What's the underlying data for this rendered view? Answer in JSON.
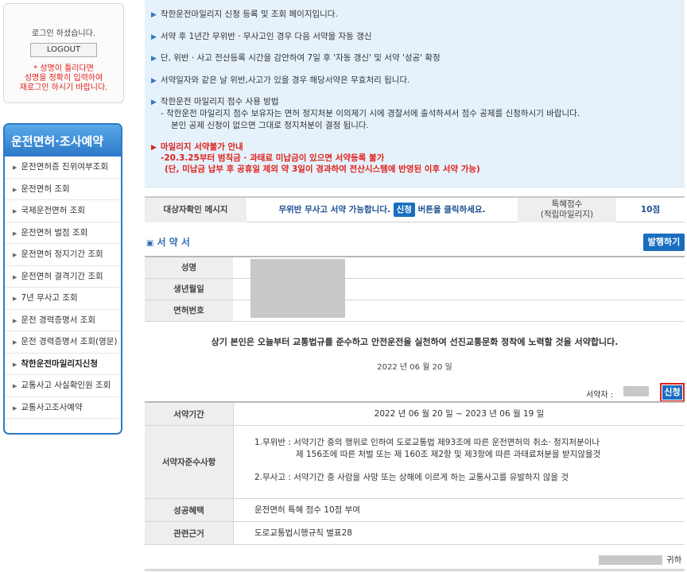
{
  "login": {
    "message": "로그인 하셨습니다.",
    "logout_label": "LOGOUT",
    "warning_lines": [
      "* 성명이 틀리다면",
      "성명을 정확히 입력하여",
      "재로그인 하시기 바랍니다."
    ]
  },
  "menu": {
    "title": "운전면허·조사예약",
    "items": [
      "운전면허증 진위여부조회",
      "운전면허 조회",
      "국제운전면허 조회",
      "운전면허 벌점 조회",
      "운전면허 정지기간 조회",
      "운전면허 결격기간 조회",
      "7년 무사고 조회",
      "운전 경력증명서 조회",
      "운전 경력증명서 조회(영문)",
      "착한운전마일리지신청",
      "교통사고 사실확인원 조회",
      "교통사고조사예약"
    ],
    "active_index": 9
  },
  "notice": {
    "lines": [
      "착한운전마일리지 신청 등록 및 조회 페이지입니다.",
      "서약 후 1년간 무위반 · 무사고인 경우 다음 서약을 자동 갱신",
      "단, 위반 · 사고 전산등록 시간을 감안하여 7일 후 '자동 갱신' 및 서약 '성공' 확정",
      "서약일자와 같은 날 위반,사고가 있을 경우 해당서약은 무효처리 됩니다."
    ],
    "usage_title": "착한운전 마일리지 점수 사용 방법",
    "usage_lines": [
      "- 착한운전 마일리지 점수 보유자는 면허 정지처분 이의제기 시에 경찰서에 출석하셔서 점수 공제를 신청하시기 바랍니다.",
      "본인 공제 신청이 없으면 그대로 정지처분이 결정 됩니다."
    ],
    "warning_title": "마일리지 서약불가 안내",
    "warning_lines": [
      "-20.3.25부터 범칙금 · 과태료 미납금이 있으면 서약등록 불가",
      "(단, 미납금 납부 후 공휴일 제외 약 3일이 경과하여 전산시스템에 반영된 이후 서약 가능)"
    ]
  },
  "target": {
    "label": "대상자확인 메시지",
    "message_before": "무위반 무사고 서약 가능합니다.",
    "button_label": "신청",
    "message_after": "버튼을 클릭하세요.",
    "points_label_1": "특혜점수",
    "points_label_2": "(적립마일리지)",
    "points_value": "10점"
  },
  "pledge": {
    "section_title": "서 약 서",
    "issue_label": "발행하기",
    "fields": [
      "성명",
      "생년월일",
      "면허번호"
    ],
    "statement": "상기 본인은 오늘부터 교통법규를 준수하고 안전운전을 실천하여 선진교통문화 정착에 노력할 것을 서약합니다.",
    "date": "2022 년 06 월 20 일",
    "signer_label": "서약자 :",
    "sign_button": "신청"
  },
  "details": {
    "period_label": "서약기간",
    "period_value": "2022 년 06 월 20 일 ~ 2023 년 06 월 19 일",
    "terms_label": "서약자준수사항",
    "terms_lines": [
      "1.무위반 : 서약기간 중의 행위로 인하여 도로교통법 제93조에 따른 운전면허의 취소· 정지처분이나",
      "제 156조에 따른 처벌 또는 제 160조 제2항 및 제3항에 따른 과태료처분을 받지않을것",
      "2.무사고 : 서약기간 중 사람을 사망 또는 상해에 이르게 하는 교통사고를 유발하지 않을 것"
    ],
    "benefit_label": "성공혜택",
    "benefit_value": "운전면허 특혜 점수 10점 부여",
    "basis_label": "관련근거",
    "basis_value": "도로교통법시행규칙 별표28"
  },
  "footer": {
    "addressee_suffix": "귀하"
  }
}
